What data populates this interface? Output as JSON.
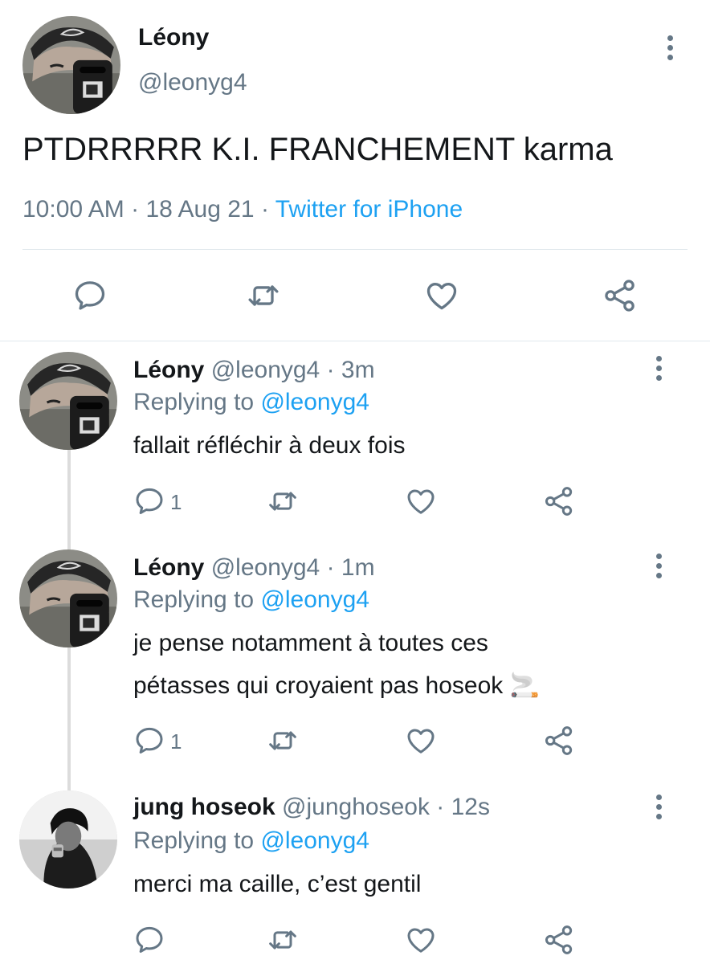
{
  "main_tweet": {
    "author_name": "Léony",
    "author_handle": "@leonyg4",
    "text": "PTDRRRRR K.I. FRANCHEMENT karma",
    "time": "10:00 AM",
    "date": "18 Aug 21",
    "separator": "·",
    "source": "Twitter for iPhone"
  },
  "replies": [
    {
      "author_name": "Léony",
      "author_handle": "@leonyg4",
      "age": "· 3m",
      "replying_label": "Replying to",
      "replying_handle": "@leonyg4",
      "text_lines": [
        "fallait réfléchir à deux fois"
      ],
      "reply_count": "1"
    },
    {
      "author_name": "Léony",
      "author_handle": "@leonyg4",
      "age": "· 1m",
      "replying_label": "Replying to",
      "replying_handle": "@leonyg4",
      "text_lines": [
        "je pense notamment à toutes ces",
        "pétasses qui croyaient pas hoseok 🚬"
      ],
      "reply_count": "1"
    },
    {
      "author_name": "jung hoseok",
      "author_handle": "@junghoseok",
      "age": "· 12s",
      "replying_label": "Replying to",
      "replying_handle": "@leonyg4",
      "text_lines": [
        "merci ma caille, c’est gentil"
      ],
      "reply_count": ""
    }
  ],
  "icons": {
    "reply": "reply-icon",
    "retweet": "retweet-icon",
    "like": "like-icon",
    "share": "share-icon",
    "more": "more-vertical-icon"
  },
  "colors": {
    "text": "#14171a",
    "secondary": "#657786",
    "link": "#1da1f2",
    "divider": "#e1e8ed"
  }
}
